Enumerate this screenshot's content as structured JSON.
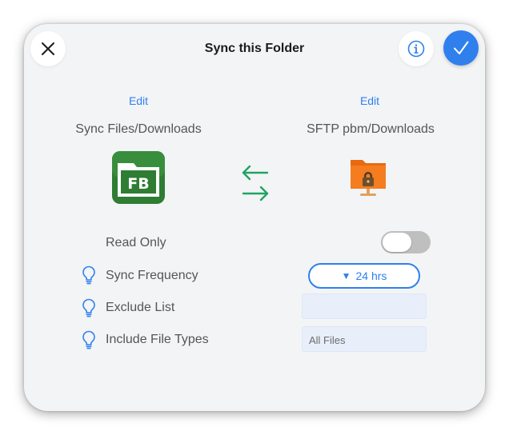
{
  "header": {
    "title": "Sync this Folder"
  },
  "left_endpoint": {
    "edit_label": "Edit",
    "name": "Sync Files/Downloads",
    "icon": "fb-app-icon",
    "icon_text": "FB"
  },
  "right_endpoint": {
    "edit_label": "Edit",
    "name": "SFTP pbm/Downloads",
    "icon": "sftp-server-folder-icon"
  },
  "sync_direction": "two-way",
  "settings": {
    "read_only": {
      "label": "Read Only",
      "enabled": false
    },
    "sync_frequency": {
      "label": "Sync Frequency",
      "value": "24 hrs"
    },
    "exclude_list": {
      "label": "Exclude List",
      "value": ""
    },
    "include_file_types": {
      "label": "Include File Types",
      "value": "All Files"
    }
  },
  "colors": {
    "accent": "#2f80ed",
    "fb_green": "#2e7d32",
    "sync_arrow_green": "#1fa463",
    "sftp_orange": "#f57c1f"
  }
}
